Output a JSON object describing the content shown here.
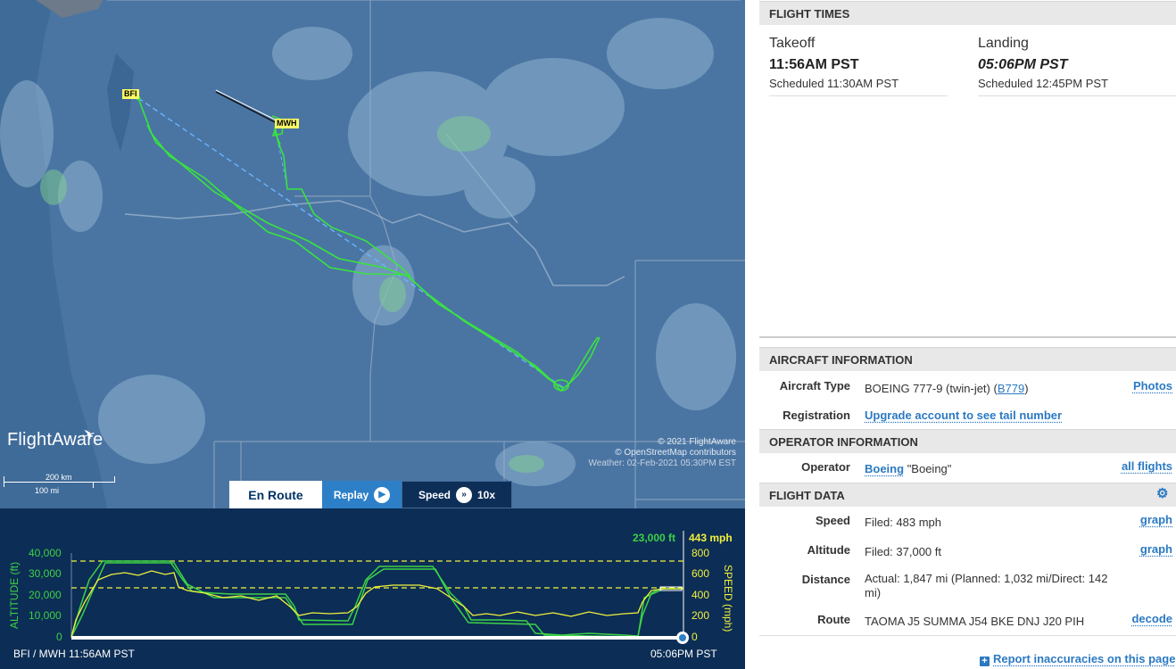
{
  "map": {
    "origin_code": "BFI",
    "dest_code": "MWH",
    "logo_text": "FlightAware",
    "scale_km": "200 km",
    "scale_mi": "100 mi",
    "attribution_1": "© 2021 FlightAware",
    "attribution_2": "© OpenStreetMap contributors",
    "attribution_3": "Weather: 02-Feb-2021 05:30PM EST",
    "controls": {
      "route_label": "En Route",
      "replay_label": "Replay",
      "speed_label": "Speed",
      "speed_value": "10x"
    }
  },
  "graph": {
    "current_altitude": "23,000 ft",
    "current_speed": "443 mph",
    "altitude_axis_label": "ALTITUDE (ft)",
    "speed_axis_label": "SPEED (mph)",
    "altitude_ticks": [
      "40,000",
      "30,000",
      "20,000",
      "10,000",
      "0"
    ],
    "speed_ticks": [
      "800",
      "600",
      "400",
      "200",
      "0"
    ],
    "start_label": "BFI / MWH 11:56AM PST",
    "end_label": "05:06PM PST",
    "colors": {
      "altitude": "#3cd147",
      "speed": "#f1f13d",
      "background": "#0c2d55"
    }
  },
  "flight_times": {
    "header": "FLIGHT TIMES",
    "takeoff_label": "Takeoff",
    "takeoff_time": "11:56AM PST",
    "takeoff_scheduled": "Scheduled 11:30AM PST",
    "landing_label": "Landing",
    "landing_time": "05:06PM PST",
    "landing_scheduled": "Scheduled 12:45PM PST"
  },
  "aircraft": {
    "header": "AIRCRAFT INFORMATION",
    "type_label": "Aircraft Type",
    "type_value": "BOEING 777-9 (twin-jet) (",
    "type_code": "B779",
    "type_close": ")",
    "photos": "Photos",
    "registration_label": "Registration",
    "registration_value": "Upgrade account to see tail number"
  },
  "operator": {
    "header": "OPERATOR INFORMATION",
    "label": "Operator",
    "name": "Boeing",
    "alias": "\"Boeing\"",
    "all_flights": "all flights"
  },
  "flight_data": {
    "header": "FLIGHT DATA",
    "speed_label": "Speed",
    "speed_value": "Filed: 483 mph",
    "altitude_label": "Altitude",
    "altitude_value": "Filed: 37,000 ft",
    "distance_label": "Distance",
    "distance_value": "Actual: 1,847 mi (Planned: 1,032 mi/Direct: 142 mi)",
    "route_label": "Route",
    "route_value": "TAOMA J5 SUMMA J54 BKE DNJ J20 PIH",
    "graph_link": "graph",
    "decode_link": "decode"
  },
  "report_link": "Report inaccuracies on this page"
}
